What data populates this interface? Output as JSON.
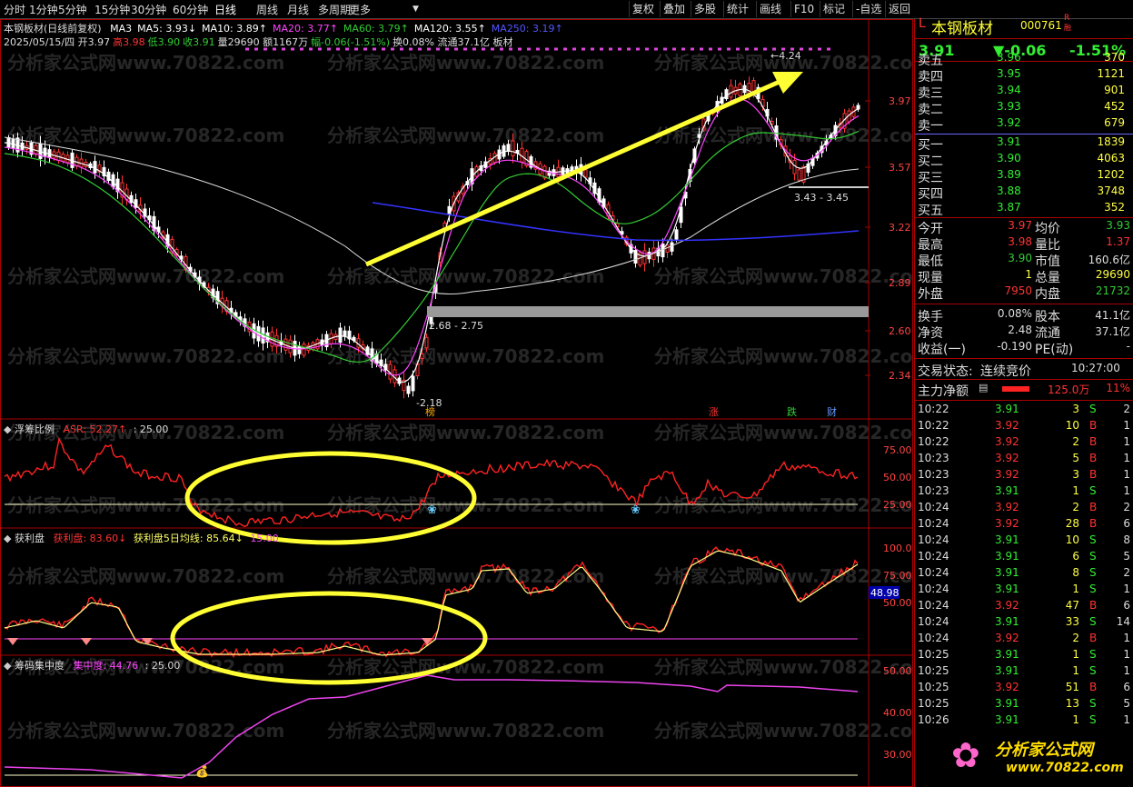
{
  "toolbar": {
    "periods": [
      "分时",
      "1分钟",
      "5分钟",
      "15分钟",
      "30分钟",
      "60分钟",
      "日线",
      "周线",
      "月线",
      "多周期",
      "更多"
    ],
    "right_buttons": [
      "复权",
      "叠加",
      "多股",
      "统计",
      "画线",
      "F10",
      "标记",
      "-自选",
      "返回"
    ]
  },
  "stock": {
    "prefix": "L",
    "name": "本钢板材",
    "code": "000761",
    "badge_top": "R",
    "badge_bottom": "融",
    "price": "3.91",
    "change": "▼-0.06",
    "pct": "-1.51%"
  },
  "main_chart": {
    "title": "本钢板材(日线前复权)",
    "ma_legend": [
      {
        "label": "MA3",
        "color": "#ffffff"
      },
      {
        "label": "MA5: 3.93↓",
        "color": "#ffffff"
      },
      {
        "label": "MA10: 3.89↑",
        "color": "#ffffff"
      },
      {
        "label": "MA20: 3.77↑",
        "color": "#ff44ff"
      },
      {
        "label": "MA60: 3.79↑",
        "color": "#33cc33"
      },
      {
        "label": "MA120: 3.55↑",
        "color": "#ffffff"
      },
      {
        "label": "MA250: 3.19↑",
        "color": "#5555ff"
      }
    ],
    "info_line": [
      {
        "text": "2025/05/15/四 开3.97",
        "color": "#dddddd"
      },
      {
        "text": "高3.98",
        "color": "#ff3333"
      },
      {
        "text": "低3.90",
        "color": "#33cc33"
      },
      {
        "text": "收3.91",
        "color": "#33cc33"
      },
      {
        "text": "量29690 额1167万",
        "color": "#dddddd"
      },
      {
        "text": "幅-0.06(-1.51%)",
        "color": "#33cc33"
      },
      {
        "text": "换0.08% 流通37.1亿 板材",
        "color": "#dddddd"
      }
    ],
    "y_ticks": [
      "3.97",
      "3.57",
      "3.22",
      "2.89",
      "2.60",
      "2.34"
    ],
    "annotations": {
      "low": "2.18",
      "high": "4.24",
      "zone_low": "2.68 - 2.75",
      "zone_high": "3.43 - 3.45"
    },
    "markers": {
      "bang": "榜",
      "zhang": "涨",
      "die": "跌",
      "cai": "财"
    }
  },
  "panel1": {
    "name": "浮筹比例",
    "series_label": "ASR: 52.27↑",
    "level": ": 25.00",
    "y_ticks": [
      "75.00",
      "50.00",
      "25.00"
    ]
  },
  "panel2": {
    "name": "获利盘",
    "series_label": "获利盘: 83.60↓",
    "ma_label": "获利盘5日均线: 85.64↓",
    "level": "15.00",
    "y_ticks": [
      "100.0",
      "75.00",
      "50.00"
    ],
    "tag": "48.98"
  },
  "panel3": {
    "name": "筹码集中度",
    "series_label": "集中度: 44.76",
    "level": ": 25.00",
    "y_ticks": [
      "50.00",
      "40.00",
      "30.00"
    ]
  },
  "quote": {
    "asks": [
      {
        "label": "卖五",
        "price": "3.96",
        "vol": "370"
      },
      {
        "label": "卖四",
        "price": "3.95",
        "vol": "1121"
      },
      {
        "label": "卖三",
        "price": "3.94",
        "vol": "901"
      },
      {
        "label": "卖二",
        "price": "3.93",
        "vol": "452"
      },
      {
        "label": "卖一",
        "price": "3.92",
        "vol": "679"
      }
    ],
    "bids": [
      {
        "label": "买一",
        "price": "3.91",
        "vol": "1839"
      },
      {
        "label": "买二",
        "price": "3.90",
        "vol": "4063"
      },
      {
        "label": "买三",
        "price": "3.89",
        "vol": "1202"
      },
      {
        "label": "买四",
        "price": "3.88",
        "vol": "3748"
      },
      {
        "label": "买五",
        "price": "3.87",
        "vol": "352"
      }
    ],
    "stats": [
      {
        "l1": "今开",
        "v1": "3.97",
        "c1": "#ff3333",
        "l2": "均价",
        "v2": "3.93",
        "c2": "#33cc33"
      },
      {
        "l1": "最高",
        "v1": "3.98",
        "c1": "#ff3333",
        "l2": "量比",
        "v2": "1.37",
        "c2": "#ff3333"
      },
      {
        "l1": "最低",
        "v1": "3.90",
        "c1": "#33cc33",
        "l2": "市值",
        "v2": "160.6亿",
        "c2": "#dddddd"
      },
      {
        "l1": "现量",
        "v1": "1",
        "c1": "#ffff44",
        "l2": "总量",
        "v2": "29690",
        "c2": "#ffff44"
      },
      {
        "l1": "外盘",
        "v1": "7950",
        "c1": "#ff3333",
        "l2": "内盘",
        "v2": "21732",
        "c2": "#33cc33"
      }
    ],
    "stats2": [
      {
        "l1": "换手",
        "v1": "0.08%",
        "l2": "股本",
        "v2": "41.1亿"
      },
      {
        "l1": "净资",
        "v1": "2.48",
        "l2": "流通",
        "v2": "37.1亿"
      },
      {
        "l1": "收益(一)",
        "v1": "-0.190",
        "l2": "PE(动)",
        "v2": "-"
      }
    ],
    "status_label": "交易状态:",
    "status_value": "连续竞价",
    "status_time": "10:27:00",
    "main_flow_label": "主力净额",
    "main_flow_value": "125.0万",
    "main_flow_pct": "11%"
  },
  "ticks": [
    {
      "t": "10:22",
      "p": "3.91",
      "v": "3",
      "s": "S",
      "n": "2"
    },
    {
      "t": "10:22",
      "p": "3.92",
      "v": "10",
      "s": "B",
      "n": "1"
    },
    {
      "t": "10:22",
      "p": "3.92",
      "v": "2",
      "s": "B",
      "n": "1"
    },
    {
      "t": "10:23",
      "p": "3.92",
      "v": "5",
      "s": "B",
      "n": "1"
    },
    {
      "t": "10:23",
      "p": "3.92",
      "v": "3",
      "s": "B",
      "n": "1"
    },
    {
      "t": "10:23",
      "p": "3.91",
      "v": "1",
      "s": "S",
      "n": "1"
    },
    {
      "t": "10:24",
      "p": "3.92",
      "v": "2",
      "s": "B",
      "n": "2"
    },
    {
      "t": "10:24",
      "p": "3.92",
      "v": "28",
      "s": "B",
      "n": "6"
    },
    {
      "t": "10:24",
      "p": "3.91",
      "v": "10",
      "s": "S",
      "n": "8"
    },
    {
      "t": "10:24",
      "p": "3.91",
      "v": "6",
      "s": "S",
      "n": "5"
    },
    {
      "t": "10:24",
      "p": "3.91",
      "v": "8",
      "s": "S",
      "n": "2"
    },
    {
      "t": "10:24",
      "p": "3.91",
      "v": "1",
      "s": "S",
      "n": "1"
    },
    {
      "t": "10:24",
      "p": "3.92",
      "v": "47",
      "s": "B",
      "n": "6"
    },
    {
      "t": "10:24",
      "p": "3.91",
      "v": "33",
      "s": "S",
      "n": "14"
    },
    {
      "t": "10:24",
      "p": "3.92",
      "v": "2",
      "s": "B",
      "n": "1"
    },
    {
      "t": "10:25",
      "p": "3.91",
      "v": "1",
      "s": "S",
      "n": "1"
    },
    {
      "t": "10:25",
      "p": "3.91",
      "v": "1",
      "s": "S",
      "n": "1"
    },
    {
      "t": "10:25",
      "p": "3.92",
      "v": "51",
      "s": "B",
      "n": "6"
    },
    {
      "t": "10:25",
      "p": "3.91",
      "v": "13",
      "s": "S",
      "n": "5"
    },
    {
      "t": "10:26",
      "p": "3.91",
      "v": "1",
      "s": "S",
      "n": "1"
    }
  ],
  "watermark": "分析家公式网www.70822.com",
  "logo": {
    "text": "分析家公式网",
    "url": "www.70822.com"
  }
}
